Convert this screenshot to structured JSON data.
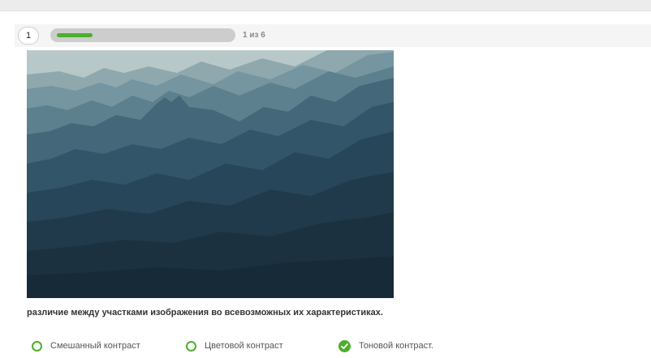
{
  "progress": {
    "question_number": "1",
    "counter_text": "1 из 6",
    "fraction": 0.1667
  },
  "question": {
    "image_alt": "canyon-silhouette-landscape",
    "text": "различие между участками изображения во всевозможных их характеристиках."
  },
  "answers": [
    {
      "label": "Смешанный контраст",
      "selected": false
    },
    {
      "label": "Цветовой контраст",
      "selected": false
    },
    {
      "label": "Тоновой контраст.",
      "selected": true
    }
  ],
  "colors": {
    "accent": "#4caf2c",
    "track": "#cdcdcd"
  }
}
